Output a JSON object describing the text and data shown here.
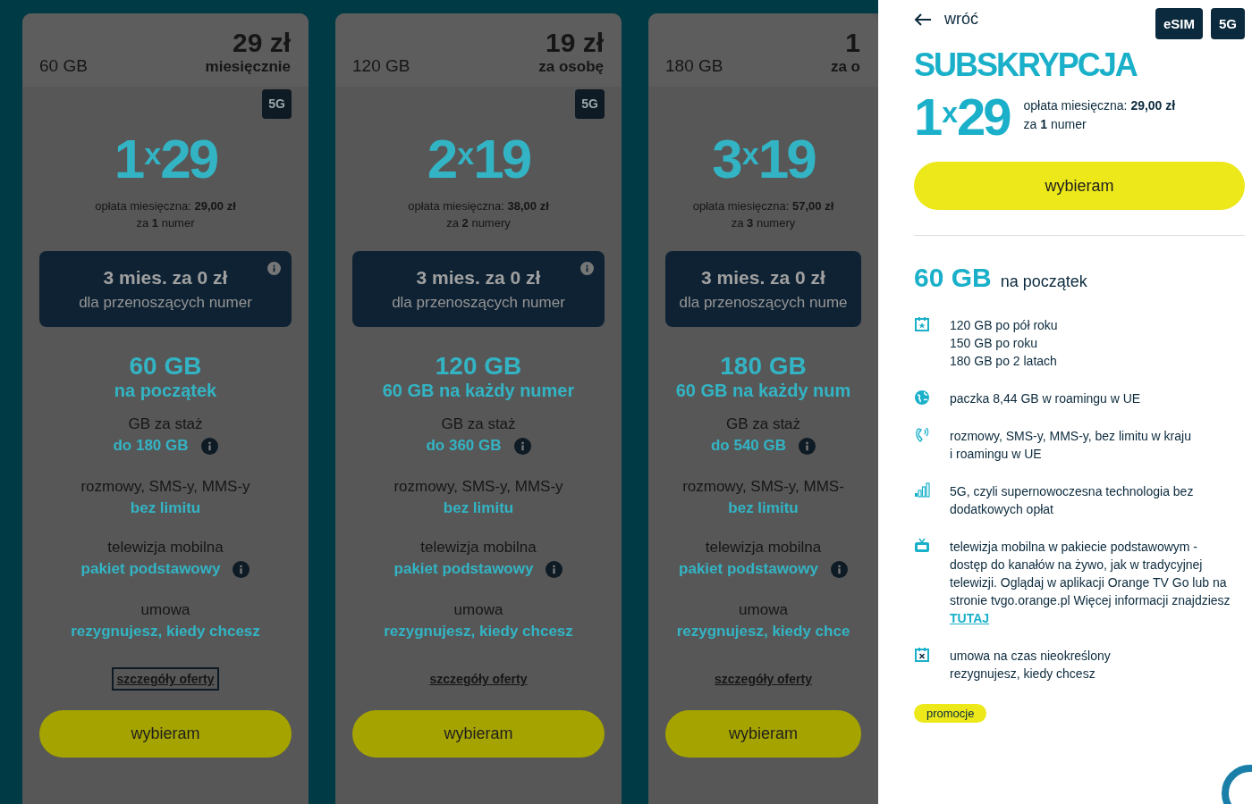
{
  "plans": [
    {
      "data": "60 GB",
      "price": "29 zł",
      "price_note": "miesięcznie",
      "badge": "5G",
      "count": "1",
      "times": "x",
      "amount": "29",
      "fee": "opłata miesięczna: **29,00 zł**",
      "numbers": "za **1** numer",
      "promo_title": "3 mies. za 0 zł",
      "promo_sub": "dla przenoszących numer",
      "promo_info": true,
      "gb": "60 GB",
      "gb_sub": "na początek",
      "loyalty_label": "GB za staż",
      "loyalty_value": "do 180 GB",
      "loyalty_info": true,
      "calls_label": "rozmowy, SMS-y, MMS-y",
      "calls_value": "bez limitu",
      "tv_label": "telewizja mobilna",
      "tv_value": "pakiet podstawowy",
      "tv_info": true,
      "contract_label": "umowa",
      "contract_value": "rezygnujesz, kiedy chcesz",
      "details": "szczegóły oferty",
      "focused": true,
      "button": "wybieram"
    },
    {
      "data": "120 GB",
      "price": "19 zł",
      "price_note": "za osobę",
      "badge": "5G",
      "count": "2",
      "times": "x",
      "amount": "19",
      "fee": "opłata miesięczna: **38,00 zł**",
      "numbers": "za **2** numery",
      "promo_title": "3 mies. za 0 zł",
      "promo_sub": "dla przenoszących numer",
      "promo_info": true,
      "gb": "120 GB",
      "gb_sub": "60 GB na każdy numer",
      "loyalty_label": "GB za staż",
      "loyalty_value": "do 360 GB",
      "loyalty_info": true,
      "calls_label": "rozmowy, SMS-y, MMS-y",
      "calls_value": "bez limitu",
      "tv_label": "telewizja mobilna",
      "tv_value": "pakiet podstawowy",
      "tv_info": true,
      "contract_label": "umowa",
      "contract_value": "rezygnujesz, kiedy chcesz",
      "details": "szczegóły oferty",
      "focused": false,
      "button": "wybieram"
    },
    {
      "data": "180 GB",
      "price": "1",
      "price_note": "za o",
      "count": "3",
      "times": "x",
      "amount": "19",
      "fee": "opłata miesięczna: **57,00 zł**",
      "numbers": "za **3** numery",
      "promo_title": "3 mies. za 0 zł",
      "promo_sub": "dla przenoszących nume",
      "promo_info": false,
      "gb": "180 GB",
      "gb_sub": "60 GB na każdy num",
      "loyalty_label": "GB za staż",
      "loyalty_value": "do 540 GB",
      "loyalty_info": true,
      "calls_label": "rozmowy, SMS-y, MMS-",
      "calls_value": "bez limitu",
      "tv_label": "telewizja mobilna",
      "tv_value": "pakiet podstawowy",
      "tv_info": true,
      "contract_label": "umowa",
      "contract_value": "rezygnujesz, kiedy chce",
      "details": "szczegóły oferty",
      "focused": false,
      "button": "wybieram"
    }
  ],
  "panel": {
    "back": "wróć",
    "badges": [
      "eSIM",
      "5G"
    ],
    "title": "SUBSKRYPCJA",
    "count": "1",
    "times": "x",
    "amount": "29",
    "fee": "opłata miesięczna: **29,00 zł**",
    "numbers": "za **1** numer",
    "button": "wybieram",
    "gb": "60 GB",
    "gb_sub": "na początek",
    "features": [
      {
        "kind": "calendar-star",
        "lines": [
          "120 GB po pół roku",
          "150 GB po roku",
          "180 GB po 2 latach"
        ]
      },
      {
        "kind": "globe",
        "lines": [
          "paczka 8,44 GB w roamingu w UE"
        ]
      },
      {
        "kind": "phone",
        "lines": [
          "rozmowy, SMS-y, MMS-y, bez limitu w kraju",
          "i roamingu w UE"
        ]
      },
      {
        "kind": "signal",
        "lines": [
          "5G, czyli supernowoczesna technologia bez",
          "dodatkowych opłat"
        ]
      },
      {
        "kind": "tv",
        "text": "telewizja mobilna w pakiecie podstawowym - dostęp do kanałów na żywo, jak w tradycyjnej telewizji. Oglądaj w aplikacji Orange TV Go lub na stronie tvgo.orange.pl Więcej informacji znajdziesz",
        "link": "TUTAJ"
      },
      {
        "kind": "calendar-x",
        "lines": [
          "umowa na czas nieokreślony",
          "rezygnujesz, kiedy chcesz"
        ]
      }
    ],
    "tag": "promocje"
  }
}
